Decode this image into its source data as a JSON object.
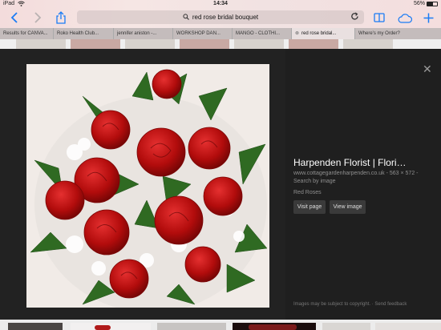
{
  "status": {
    "carrier": "iPad",
    "time": "14:34",
    "battery_pct": "56%",
    "battery_level": 0.56
  },
  "toolbar": {
    "url": "red rose bridal bouquet",
    "icons": [
      "back-icon",
      "forward-icon",
      "bookmarks-icon",
      "share-icon",
      "search-icon",
      "reload-icon",
      "reading-list-icon",
      "cloud-tabs-icon",
      "new-tab-icon"
    ]
  },
  "tabs": [
    {
      "label": "Results for CANVA..."
    },
    {
      "label": "Roko Health Club..."
    },
    {
      "label": "jennifer aniston -..."
    },
    {
      "label": "WORKSHOP DAN..."
    },
    {
      "label": "MANGO - CLOTHI..."
    },
    {
      "label": "red rose bridal..."
    },
    {
      "label": "Where's my Order?"
    }
  ],
  "result": {
    "title": "Harpenden Florist | Flori…",
    "source": "www.cottagegardenharpenden.co.uk",
    "dimensions": "563 × 572",
    "search_by_image": "Search by image",
    "description": "Red Roses",
    "visit_page": "Visit page",
    "view_image": "View image",
    "footer_notice": "Images may be subject to copyright.",
    "footer_feedback": "Send feedback"
  },
  "colors": {
    "rose": "#b40f0f",
    "panel": "#222222",
    "accent": "#1a7cf5"
  }
}
